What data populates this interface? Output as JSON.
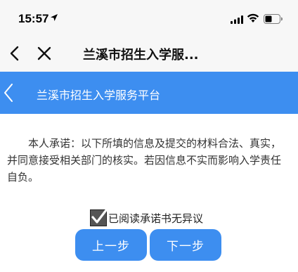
{
  "status_bar": {
    "time": "15:57",
    "icons": [
      "location-arrow-icon",
      "signal-icon",
      "wifi-icon",
      "battery-icon"
    ]
  },
  "nav_bar": {
    "title": "兰溪市招生入学服...",
    "icons": [
      "back-icon",
      "close-icon"
    ]
  },
  "app_header": {
    "title": "兰溪市招生入学服务平台",
    "background": "#3d8ef0"
  },
  "content": {
    "statement": "本人承诺：以下所填的信息及提交的材料合法、真实，并同意接受相关部门的核实。若因信息不实而影响入学责任自负。"
  },
  "agreement": {
    "label": "已阅读承诺书无异议",
    "checked": true
  },
  "buttons": {
    "prev_label": "上一步",
    "next_label": "下一步",
    "color": "#3d8ef0"
  }
}
